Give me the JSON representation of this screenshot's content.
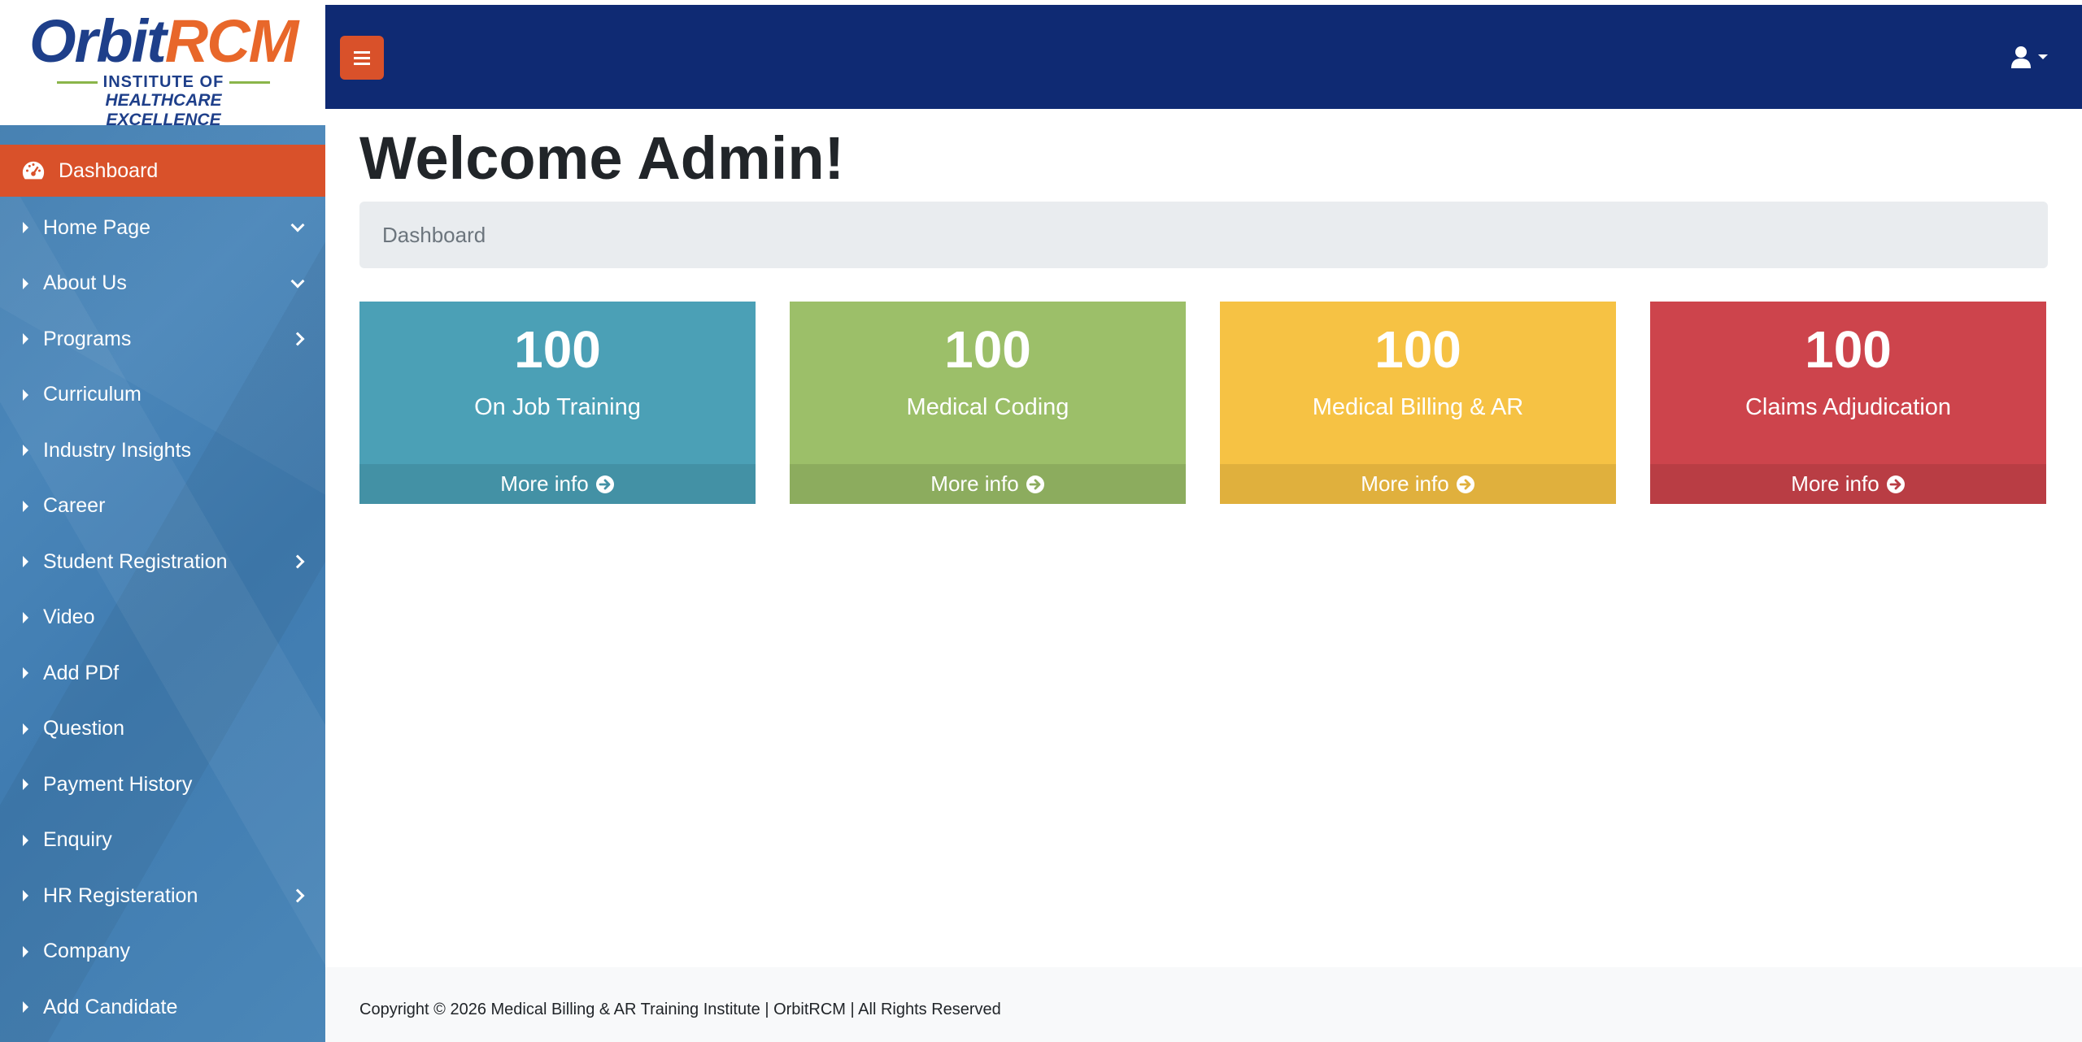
{
  "brand": {
    "name_part1": "Orbit",
    "name_part2": "RCM",
    "tagline1": "INSTITUTE OF",
    "tagline2": "HEALTHCARE EXCELLENCE"
  },
  "sidebar": {
    "items": [
      {
        "label": "Dashboard",
        "icon": "tachometer-icon",
        "active": true
      },
      {
        "label": "Home Page",
        "chevron": "down"
      },
      {
        "label": "About Us",
        "chevron": "down"
      },
      {
        "label": "Programs",
        "chevron": "right"
      },
      {
        "label": "Curriculum"
      },
      {
        "label": "Industry Insights"
      },
      {
        "label": "Career"
      },
      {
        "label": "Student Registration",
        "chevron": "right"
      },
      {
        "label": "Video"
      },
      {
        "label": "Add PDf"
      },
      {
        "label": "Question"
      },
      {
        "label": "Payment History"
      },
      {
        "label": "Enquiry"
      },
      {
        "label": "HR Registeration",
        "chevron": "right"
      },
      {
        "label": "Company"
      },
      {
        "label": "Add Candidate"
      }
    ]
  },
  "header": {
    "menu_icon": "hamburger-icon",
    "user_icon": "user-icon"
  },
  "main": {
    "title": "Welcome Admin!",
    "breadcrumb": "Dashboard",
    "cards": [
      {
        "value": "100",
        "label": "On Job Training",
        "more": "More info",
        "color": "#4ba0b6"
      },
      {
        "value": "100",
        "label": "Medical Coding",
        "more": "More info",
        "color": "#9cbf69"
      },
      {
        "value": "100",
        "label": "Medical Billing & AR",
        "more": "More info",
        "color": "#f6c244"
      },
      {
        "value": "100",
        "label": "Claims Adjudication",
        "more": "More info",
        "color": "#cd444c"
      }
    ]
  },
  "footer": {
    "text": "Copyright © 2026 Medical Billing & AR Training Institute | OrbitRCM | All Rights Reserved"
  },
  "colors": {
    "topbar": "#0f2a73",
    "accent": "#d9512a",
    "sidebar": "#4583b5"
  }
}
